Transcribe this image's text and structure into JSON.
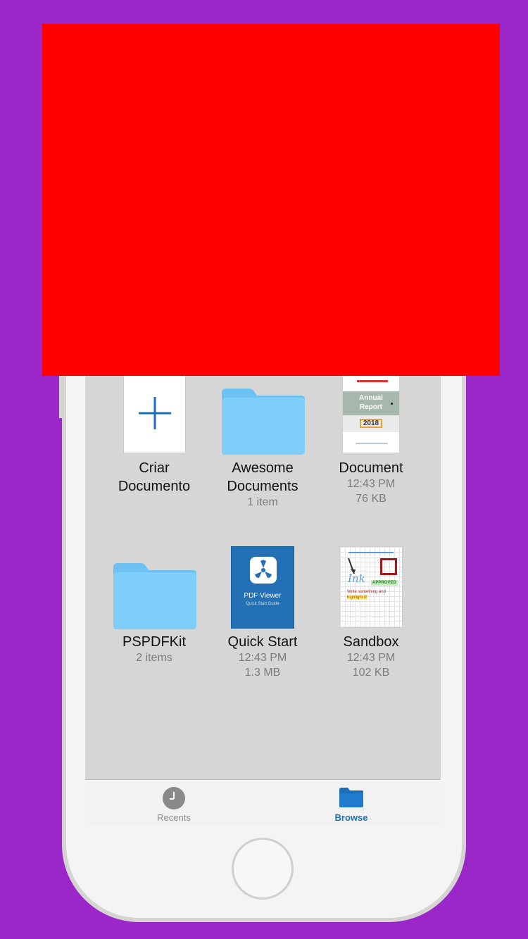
{
  "items": [
    {
      "name": "Criar\nDocumento",
      "line1": "Criar",
      "line2": "Documento",
      "meta1": "",
      "meta2": "",
      "icon": "plus-icon"
    },
    {
      "line1": "Awesome",
      "line2": "Documents",
      "meta1": "1 item",
      "meta2": "",
      "icon": "folder-icon"
    },
    {
      "line1": "Document",
      "meta1": "12:43 PM",
      "meta2": "76 KB",
      "icon": "document-thumbnail"
    },
    {
      "line1": "PSPDFKit",
      "meta1": "2 items",
      "icon": "folder-icon"
    },
    {
      "line1": "Quick Start",
      "meta1": "12:43 PM",
      "meta2": "1.3 MB",
      "icon": "pdf-viewer-thumbnail"
    },
    {
      "line1": "Sandbox",
      "meta1": "12:43 PM",
      "meta2": "102 KB",
      "icon": "sandbox-thumbnail"
    }
  ],
  "doc_thumb": {
    "title1": "Annual",
    "title2": "Report",
    "year": "2018"
  },
  "quick_thumb": {
    "title": "PDF Viewer",
    "subtitle": "Quick Start Guide"
  },
  "sandbox_thumb": {
    "ink": "Ink",
    "approved": "APPROVED",
    "text1": "Write something and",
    "text2": "highlight it!"
  },
  "tabbar": {
    "recents_label": "Recents",
    "browse_label": "Browse"
  },
  "colors": {
    "background": "#9b27c9",
    "banner": "#fe0000",
    "accent": "#1a6fb7",
    "folder": "#75c8f7"
  }
}
